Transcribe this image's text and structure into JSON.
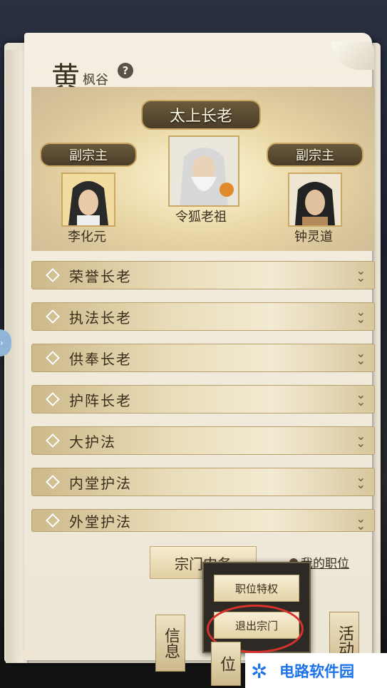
{
  "header": {
    "surname": "黄",
    "sect_name": "枫谷",
    "help_symbol": "?"
  },
  "leaders": {
    "title_main": "太上长老",
    "main_name": "令狐老祖",
    "vice_title_left": "副宗主",
    "vice_name_left": "李化元",
    "vice_title_right": "副宗主",
    "vice_name_right": "钟灵道"
  },
  "ranks": [
    {
      "label": "荣誉长老"
    },
    {
      "label": "执法长老"
    },
    {
      "label": "供奉长老"
    },
    {
      "label": "护阵长老"
    },
    {
      "label": "大护法"
    },
    {
      "label": "内堂护法"
    },
    {
      "label": "外堂护法"
    }
  ],
  "footer": {
    "sect_affairs": "宗门内务",
    "my_position": "我的职位"
  },
  "popup": {
    "privileges": "职位特权",
    "leave_sect": "退出宗门"
  },
  "side_tabs": {
    "info": "信息",
    "position": "位",
    "activity": "活动"
  },
  "watermark": {
    "text": "电路软件园"
  },
  "colors": {
    "accent": "#c9a865",
    "highlight_circle": "#d9322c",
    "watermark_blue": "#1a73e8"
  }
}
